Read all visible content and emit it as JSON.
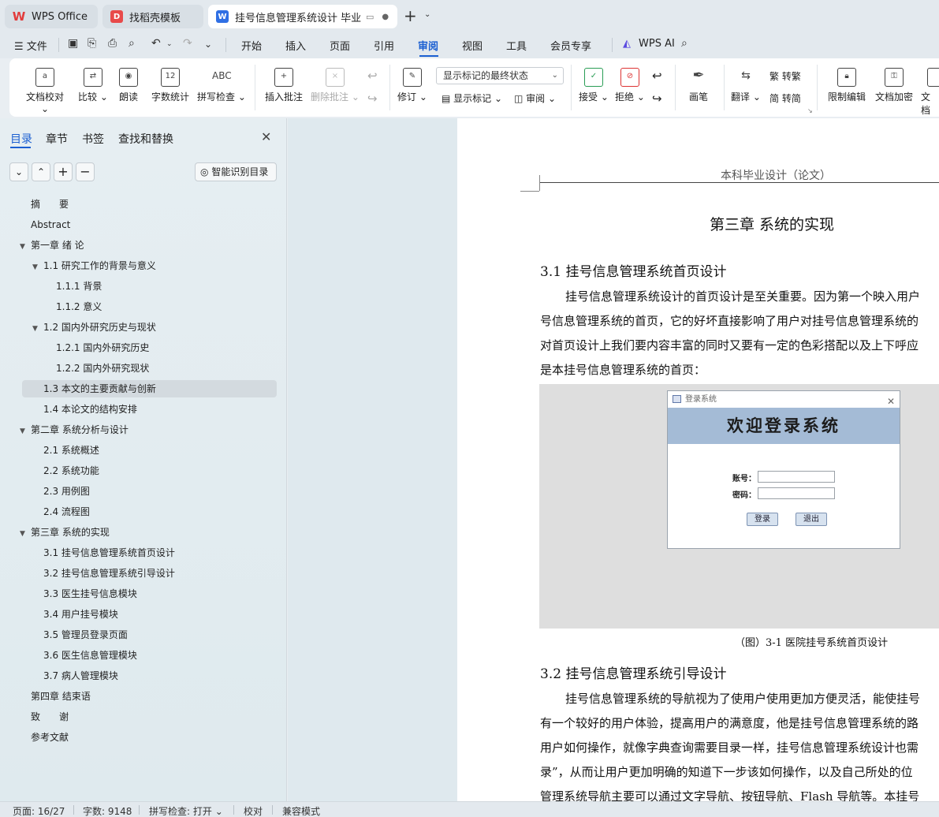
{
  "tabs": [
    {
      "label": "WPS Office"
    },
    {
      "label": "找稻壳模板"
    },
    {
      "label": "挂号信息管理系统设计 毕业论文"
    }
  ],
  "menu": {
    "file": "文件",
    "items": [
      "开始",
      "插入",
      "页面",
      "引用",
      "审阅",
      "视图",
      "工具",
      "会员专享"
    ],
    "active": "审阅",
    "ai": "WPS AI"
  },
  "ribbon": {
    "doc_check": "文档校对",
    "compare": "比较",
    "read_aloud": "朗读",
    "word_count": "字数统计",
    "spell_check": "拼写检查",
    "abc": "ABC",
    "count_icon_text": "12",
    "insert_comment": "插入批注",
    "delete_comment": "删除批注",
    "track": "修订",
    "markup_select": "显示标记的最终状态",
    "show_markup": "显示标记",
    "review": "审阅",
    "accept": "接受",
    "reject": "拒绝",
    "pen": "画笔",
    "translate": "翻译",
    "to_traditional": "转繁",
    "to_simplified": "转简",
    "restrict_edit": "限制编辑",
    "encrypt": "文档加密",
    "doc_right": "文档"
  },
  "nav": {
    "tabs": [
      "目录",
      "章节",
      "书签",
      "查找和替换"
    ],
    "smart_toc": "智能识别目录",
    "toc": [
      {
        "label": "摘　　要",
        "level": 0
      },
      {
        "label": "Abstract",
        "level": 0
      },
      {
        "label": "第一章  绪  论",
        "level": 0,
        "caret": true
      },
      {
        "label": "1.1  研究工作的背景与意义",
        "level": 1,
        "caret": true
      },
      {
        "label": "1.1.1 背景",
        "level": 2
      },
      {
        "label": "1.1.2 意义",
        "level": 2
      },
      {
        "label": "1.2  国内外研究历史与现状",
        "level": 1,
        "caret": true
      },
      {
        "label": "1.2.1 国内外研究历史",
        "level": 2
      },
      {
        "label": "1.2.2 国内外研究现状",
        "level": 2
      },
      {
        "label": "1.3  本文的主要贡献与创新",
        "level": 1,
        "active": true
      },
      {
        "label": "1.4  本论文的结构安排",
        "level": 1
      },
      {
        "label": "第二章  系统分析与设计",
        "level": 0,
        "caret": true
      },
      {
        "label": "2.1  系统概述",
        "level": 1
      },
      {
        "label": "2.2  系统功能",
        "level": 1
      },
      {
        "label": "2.3  用例图",
        "level": 1
      },
      {
        "label": "2.4  流程图",
        "level": 1
      },
      {
        "label": "第三章  系统的实现",
        "level": 0,
        "caret": true
      },
      {
        "label": "3.1  挂号信息管理系统首页设计",
        "level": 1
      },
      {
        "label": "3.2  挂号信息管理系统引导设计",
        "level": 1
      },
      {
        "label": "3.3  医生挂号信息模块",
        "level": 1
      },
      {
        "label": "3.4  用户挂号模块",
        "level": 1
      },
      {
        "label": "3.5  管理员登录页面",
        "level": 1
      },
      {
        "label": "3.6  医生信息管理模块",
        "level": 1
      },
      {
        "label": "3.7  病人管理模块",
        "level": 1
      },
      {
        "label": "第四章  结束语",
        "level": 0
      },
      {
        "label": "致　　谢",
        "level": 0
      },
      {
        "label": "参考文献",
        "level": 0
      }
    ]
  },
  "document": {
    "header": "本科毕业设计（论文）",
    "chapter_title": "第三章  系统的实现",
    "section1_title": "3.1  挂号信息管理系统首页设计",
    "section1_lines": [
      "挂号信息管理系统设计的首页设计是至关重要。因为第一个映入用户",
      "号信息管理系统的首页，它的好坏直接影响了用户对挂号信息管理系统的",
      "对首页设计上我们要内容丰富的同时又要有一定的色彩搭配以及上下呼应",
      "是本挂号信息管理系统的首页："
    ],
    "figure": {
      "window_title": "登录系统",
      "banner": "欢迎登录系统",
      "account_label": "账号：",
      "password_label": "密码：",
      "login_button": "登录",
      "exit_button": "退出"
    },
    "caption": "（图）3-1 医院挂号系统首页设计",
    "section2_title": "3.2  挂号信息管理系统引导设计",
    "section2_lines": [
      "挂号信息管理系统的导航视为了使用户使用更加方便灵活，能使挂号",
      "有一个较好的用户体验，提高用户的满意度，他是挂号信息管理系统的路",
      "用户如何操作，就像字典查询需要目录一样，挂号信息管理系统设计也需",
      "录”，从而让用户更加明确的知道下一步该如何操作，以及自己所处的位",
      "管理系统导航主要可以通过文字导航、按钮导航、Flash 导航等。本挂号"
    ]
  },
  "status": {
    "page": "页面: 16/27",
    "words": "字数: 9148",
    "spell": "拼写检查: 打开",
    "proof": "校对",
    "compat": "兼容模式"
  },
  "colors": {
    "accent": "#1b5fd1",
    "banner": "#a4bbd6"
  }
}
